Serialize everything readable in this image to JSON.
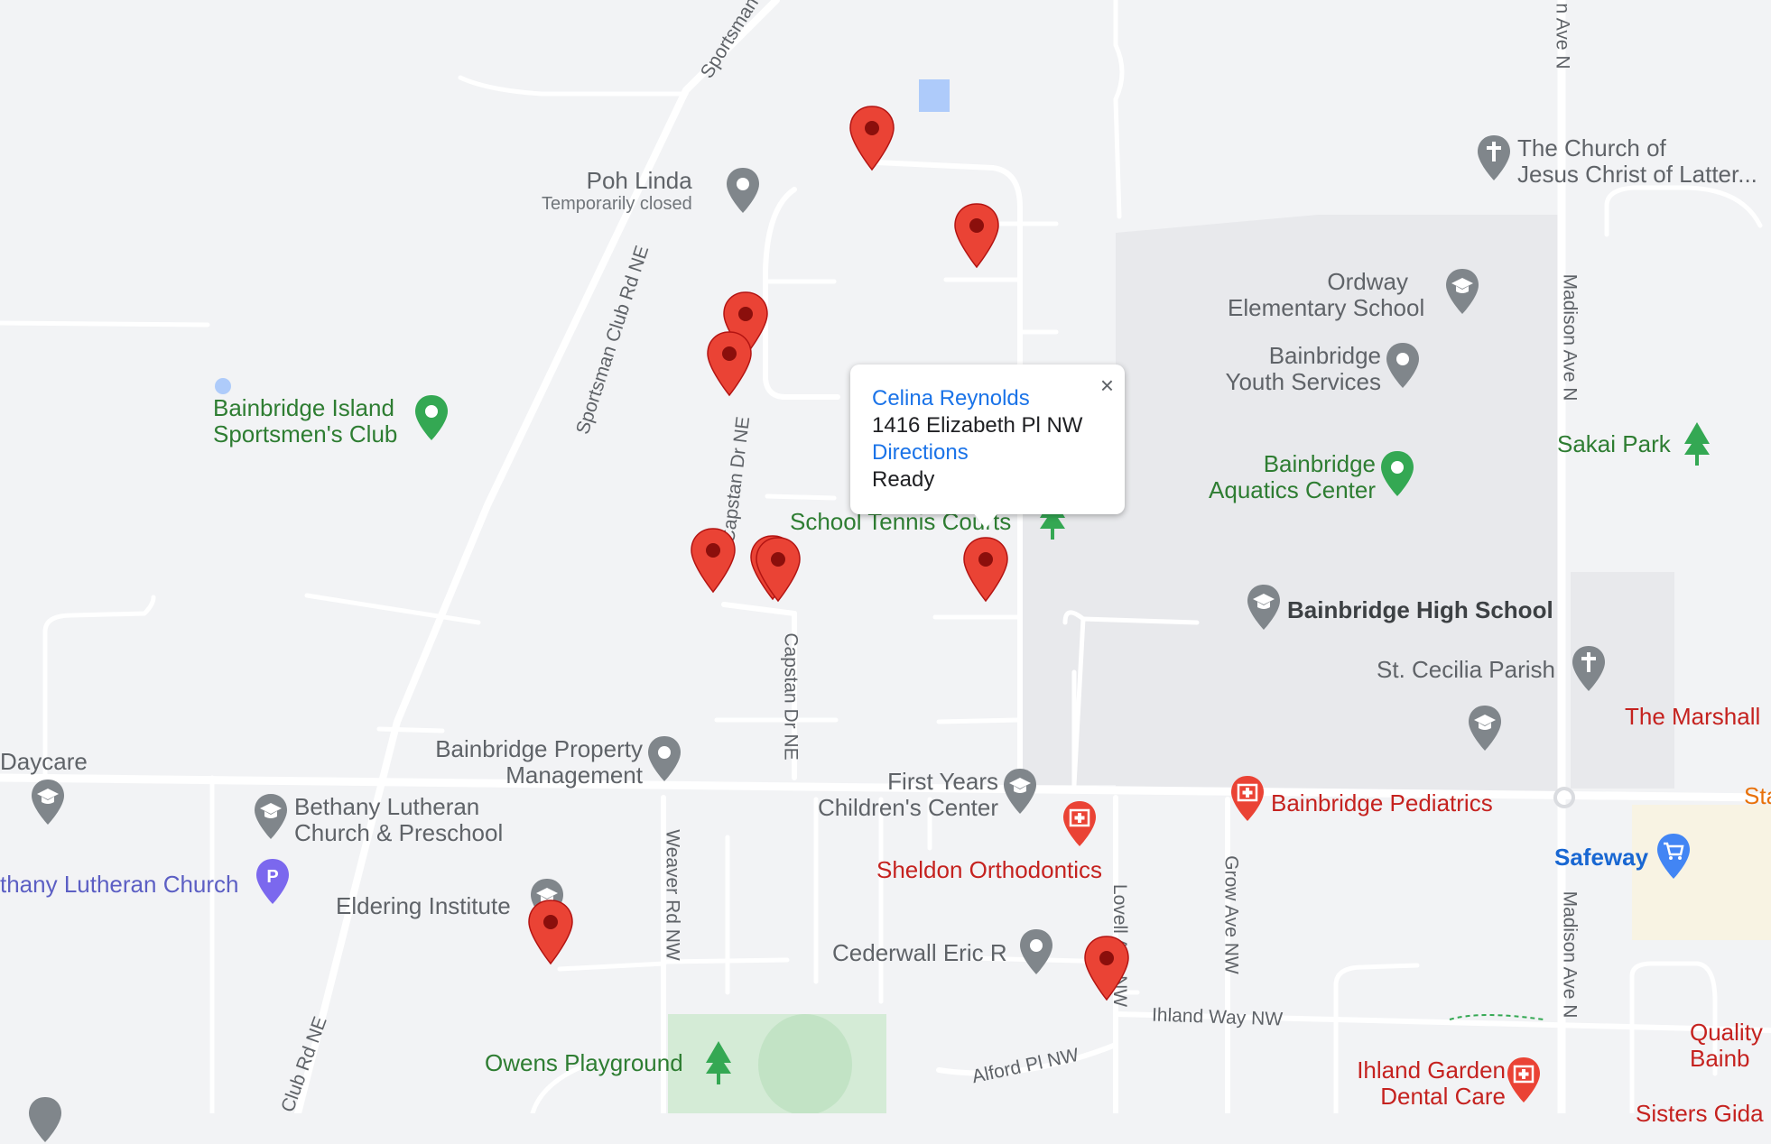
{
  "info_window": {
    "name": "Celina Reynolds",
    "address": "1416 Elizabeth Pl NW",
    "directions_label": "Directions",
    "status": "Ready",
    "close_glyph": "×"
  },
  "places": {
    "poh_linda": {
      "name": "Poh Linda",
      "sub": "Temporarily closed",
      "icon": "pin-icon",
      "color": "#80868b"
    },
    "church_lds": {
      "line1": "The Church of",
      "line2": "Jesus Christ of Latter...",
      "icon": "cross-icon"
    },
    "ordway": {
      "line1": "Ordway",
      "line2": "Elementary School",
      "icon": "school-icon"
    },
    "youth_services": {
      "line1": "Bainbridge",
      "line2": "Youth Services",
      "icon": "pin-icon"
    },
    "sportsmens_club": {
      "line1": "Bainbridge Island",
      "line2": "Sportsmen's Club",
      "icon": "pin-icon",
      "color": "#34a853"
    },
    "aquatics": {
      "line1": "Bainbridge",
      "line2": "Aquatics Center",
      "icon": "pin-icon",
      "color": "#34a853"
    },
    "sakai_park": {
      "name": "Sakai Park",
      "icon": "tree-icon"
    },
    "tennis_courts": {
      "name": "School Tennis Courts",
      "icon": "tree-icon"
    },
    "high_school": {
      "name": "Bainbridge High School",
      "icon": "school-icon"
    },
    "st_cecilia": {
      "name": "St. Cecilia Parish",
      "icon": "cross-icon"
    },
    "marshall": {
      "name": "The Marshall"
    },
    "daycare": {
      "name": "Daycare",
      "icon": "school-icon"
    },
    "property_mgmt": {
      "line1": "Bainbridge Property",
      "line2": "Management",
      "icon": "pin-icon"
    },
    "first_years": {
      "line1": "First Years",
      "line2": "Children's Center",
      "icon": "school-icon"
    },
    "pediatrics": {
      "name": "Bainbridge Pediatrics",
      "icon": "medical-icon",
      "color": "#ea4335"
    },
    "bethany_preschool": {
      "line1": "Bethany Lutheran",
      "line2": "Church & Preschool",
      "icon": "school-icon"
    },
    "bethany_church": {
      "name": "thany Lutheran Church",
      "icon": "parking-icon",
      "color": "#7b68ee"
    },
    "sheldon": {
      "name": "Sheldon Orthodontics",
      "icon": "medical-icon"
    },
    "safeway": {
      "name": "Safeway",
      "icon": "cart-icon",
      "color": "#4285f4"
    },
    "eldering": {
      "name": "Eldering Institute",
      "icon": "school-icon"
    },
    "cederwall": {
      "name": "Cederwall Eric R",
      "icon": "pin-icon"
    },
    "owens": {
      "name": "Owens Playground",
      "icon": "tree-icon"
    },
    "ihland_dental": {
      "line1": "Ihland Garden",
      "line2": "Dental Care",
      "icon": "medical-icon"
    },
    "quality": {
      "line1": "Quality",
      "line2": "Bainb"
    },
    "sisters": {
      "name": "Sisters Gida"
    },
    "sta": {
      "name": "Sta"
    }
  },
  "streets": {
    "sportsman_top": "Sportsman",
    "sportsman_mid": "Sportsman Club Rd NE",
    "sportsman_bottom": "Club Rd NE",
    "capstan_upper": "Capstan Dr NE",
    "capstan_lower": "Capstan Dr NE",
    "weaver": "Weaver Rd NW",
    "madison_top": "n Ave N",
    "madison_mid": "Madison Ave N",
    "madison_low": "Madison Ave N",
    "grow": "Grow Ave NW",
    "lovell": "Lovell Ave NW",
    "ihland_way": "Ihland Way NW",
    "alford": "Alford Pl NW"
  },
  "markers": {
    "count": 11,
    "color": "#ea4335",
    "icon": "map-marker-icon"
  },
  "colors": {
    "map_background": "#f2f3f5",
    "road": "#ffffff",
    "school_campus": "#e8e9ec",
    "park": "#d4ebd6",
    "water": "#aecbfa"
  }
}
